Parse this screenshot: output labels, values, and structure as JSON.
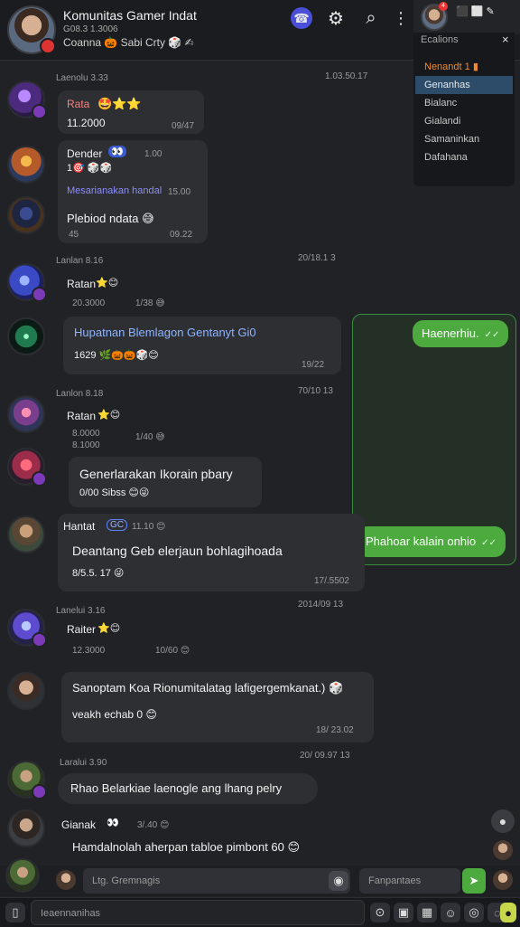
{
  "header": {
    "title": "Komunitas Gamer Indat",
    "subtitle": "G08.3 1.3006",
    "status": "Coanna 🎃 Sabi Crty 🎲 ✍",
    "icons": [
      "call-icon",
      "gear-icon",
      "search-icon",
      "more-icon"
    ]
  },
  "sidepanel": {
    "user_badge": "4",
    "mini_icons": "⬛ ⬜ ✎",
    "menu_title": "Ecalions",
    "close": "×",
    "items": [
      "Nenandt 1 ▮",
      "Genanhas",
      "Bialanc",
      "Gialandi",
      "Samaninkan",
      "Dafahana"
    ]
  },
  "messages": [
    {
      "date": "Laenolu 3.33",
      "time_right": "1.03.50.17",
      "sender": "Rata",
      "sender_emoji": "🤩⭐⭐",
      "line1": "11.2000",
      "time": "09/47",
      "avatar_color": "#7e4bd6"
    },
    {
      "sender": "Dender",
      "badge": "👀",
      "meta": "1.00",
      "line1": "1🎯 🎲🎲",
      "subsender": "Mesarianakan handal",
      "subsender_time": "15.00",
      "text": "Plebiod ndata 😅",
      "time": "09.22",
      "time2": "45",
      "avatar_color": "#d9792e"
    },
    {
      "date": "Lanlan 8.16",
      "time_right": "20/18.1 3",
      "sender": "Ratan",
      "sender_emoji": "⭐😊",
      "meta": "20.3000",
      "meta2": "1/38 😅",
      "quoted": "Hupatnan Blemlagon Gentanyt Gi0",
      "line2": "1629 🌿🎃🎃🎲😊",
      "time": "19/22"
    },
    {
      "date": "Lanlon 8.18",
      "time_right": "70/10 13",
      "sender": "Ratan",
      "sender_emoji": "⭐😊",
      "meta": "8.0000",
      "meta2": "1/40 😅",
      "line1": "8.1000",
      "text": "Generlarakan Ikorain pbary",
      "line2": "0/00 Sibss 😊😜"
    },
    {
      "sender": "Hantat",
      "badge": "GC",
      "meta": "11.10 😊",
      "text": "Deantang Geb elerjaun bohlagihoada",
      "line2": "8/5.5. 17 😜",
      "time": "17/.5502"
    },
    {
      "date": "Lanelui 3.16",
      "time_right": "2014/09 13",
      "sender": "Raiter",
      "sender_emoji": "⭐😊",
      "meta": "12.3000",
      "meta2": "10/60 😊"
    },
    {
      "text": "Sanoptam Koa Rionumitalatag lafigergemkanat.) 🎲",
      "line2": "veakh echab 0 😊",
      "time": "18/ 23.02"
    },
    {
      "date": "Laralui 3.90",
      "time_right": "20/ 09.97 13",
      "text": "Rhao Belarkiae laenogle ang lhang pelry"
    },
    {
      "sender": "Gianak",
      "badge": "👀",
      "meta": "3/.40 😊",
      "text": "Hamdalnolah aherpan tabloe pimbont 60 😊"
    }
  ],
  "replies": {
    "reply1": "Haenerhiu.",
    "reply2": "Phahoar kalain onhio",
    "tick": "✓✓"
  },
  "composer": {
    "placeholder": "Ltg. Gremnagis",
    "secondary_placeholder": "Fanpantaes",
    "bottom_placeholder": "Ieaennanihas",
    "icons": [
      "attach-icon",
      "sticker-icon",
      "gif-icon",
      "image-icon",
      "emoji-icon",
      "mic-icon",
      "send-icon"
    ]
  }
}
